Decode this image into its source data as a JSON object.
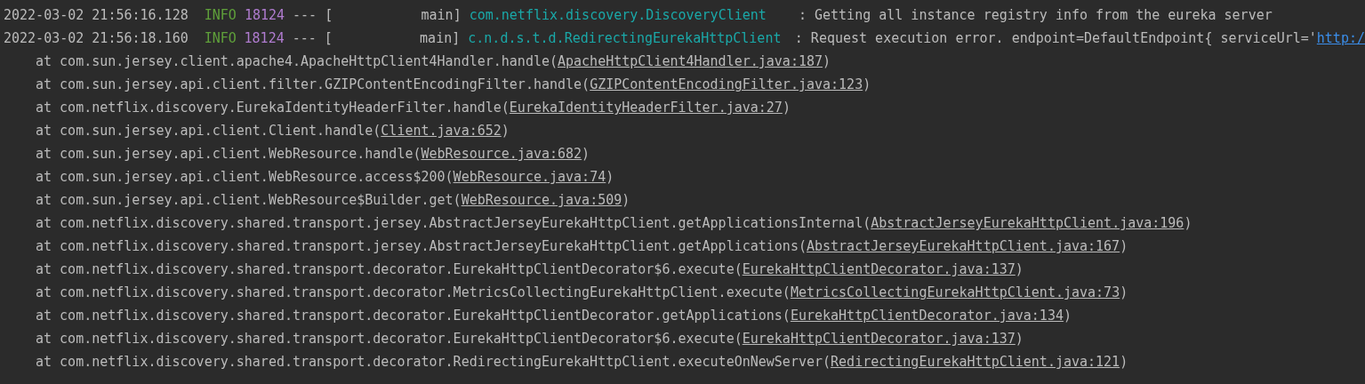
{
  "log_lines": [
    {
      "timestamp": "2022-03-02 21:56:16.128",
      "level": "INFO",
      "pid": "18124",
      "separator": "---",
      "thread_open": "[",
      "thread": "main]",
      "logger": "com.netflix.discovery.DiscoveryClient",
      "message": ": Getting all instance registry info from the eureka server"
    },
    {
      "timestamp": "2022-03-02 21:56:18.160",
      "level": "INFO",
      "pid": "18124",
      "separator": "---",
      "thread_open": "[",
      "thread": "main]",
      "logger": "c.n.d.s.t.d.RedirectingEurekaHttpClient",
      "message": ": Request execution error. endpoint=DefaultEndpoint{ serviceUrl='",
      "link": "http:/"
    }
  ],
  "stack_frames": [
    {
      "call": "at com.sun.jersey.client.apache4.ApacheHttpClient4Handler.handle(",
      "source": "ApacheHttpClient4Handler.java:187",
      "close": ")"
    },
    {
      "call": "at com.sun.jersey.api.client.filter.GZIPContentEncodingFilter.handle(",
      "source": "GZIPContentEncodingFilter.java:123",
      "close": ")"
    },
    {
      "call": "at com.netflix.discovery.EurekaIdentityHeaderFilter.handle(",
      "source": "EurekaIdentityHeaderFilter.java:27",
      "close": ")"
    },
    {
      "call": "at com.sun.jersey.api.client.Client.handle(",
      "source": "Client.java:652",
      "close": ")"
    },
    {
      "call": "at com.sun.jersey.api.client.WebResource.handle(",
      "source": "WebResource.java:682",
      "close": ")"
    },
    {
      "call": "at com.sun.jersey.api.client.WebResource.access$200(",
      "source": "WebResource.java:74",
      "close": ")"
    },
    {
      "call": "at com.sun.jersey.api.client.WebResource$Builder.get(",
      "source": "WebResource.java:509",
      "close": ")"
    },
    {
      "call": "at com.netflix.discovery.shared.transport.jersey.AbstractJerseyEurekaHttpClient.getApplicationsInternal(",
      "source": "AbstractJerseyEurekaHttpClient.java:196",
      "close": ")"
    },
    {
      "call": "at com.netflix.discovery.shared.transport.jersey.AbstractJerseyEurekaHttpClient.getApplications(",
      "source": "AbstractJerseyEurekaHttpClient.java:167",
      "close": ")"
    },
    {
      "call": "at com.netflix.discovery.shared.transport.decorator.EurekaHttpClientDecorator$6.execute(",
      "source": "EurekaHttpClientDecorator.java:137",
      "close": ")"
    },
    {
      "call": "at com.netflix.discovery.shared.transport.decorator.MetricsCollectingEurekaHttpClient.execute(",
      "source": "MetricsCollectingEurekaHttpClient.java:73",
      "close": ")"
    },
    {
      "call": "at com.netflix.discovery.shared.transport.decorator.EurekaHttpClientDecorator.getApplications(",
      "source": "EurekaHttpClientDecorator.java:134",
      "close": ")"
    },
    {
      "call": "at com.netflix.discovery.shared.transport.decorator.EurekaHttpClientDecorator$6.execute(",
      "source": "EurekaHttpClientDecorator.java:137",
      "close": ")"
    },
    {
      "call": "at com.netflix.discovery.shared.transport.decorator.RedirectingEurekaHttpClient.executeOnNewServer(",
      "source": "RedirectingEurekaHttpClient.java:121",
      "close": ")"
    }
  ]
}
